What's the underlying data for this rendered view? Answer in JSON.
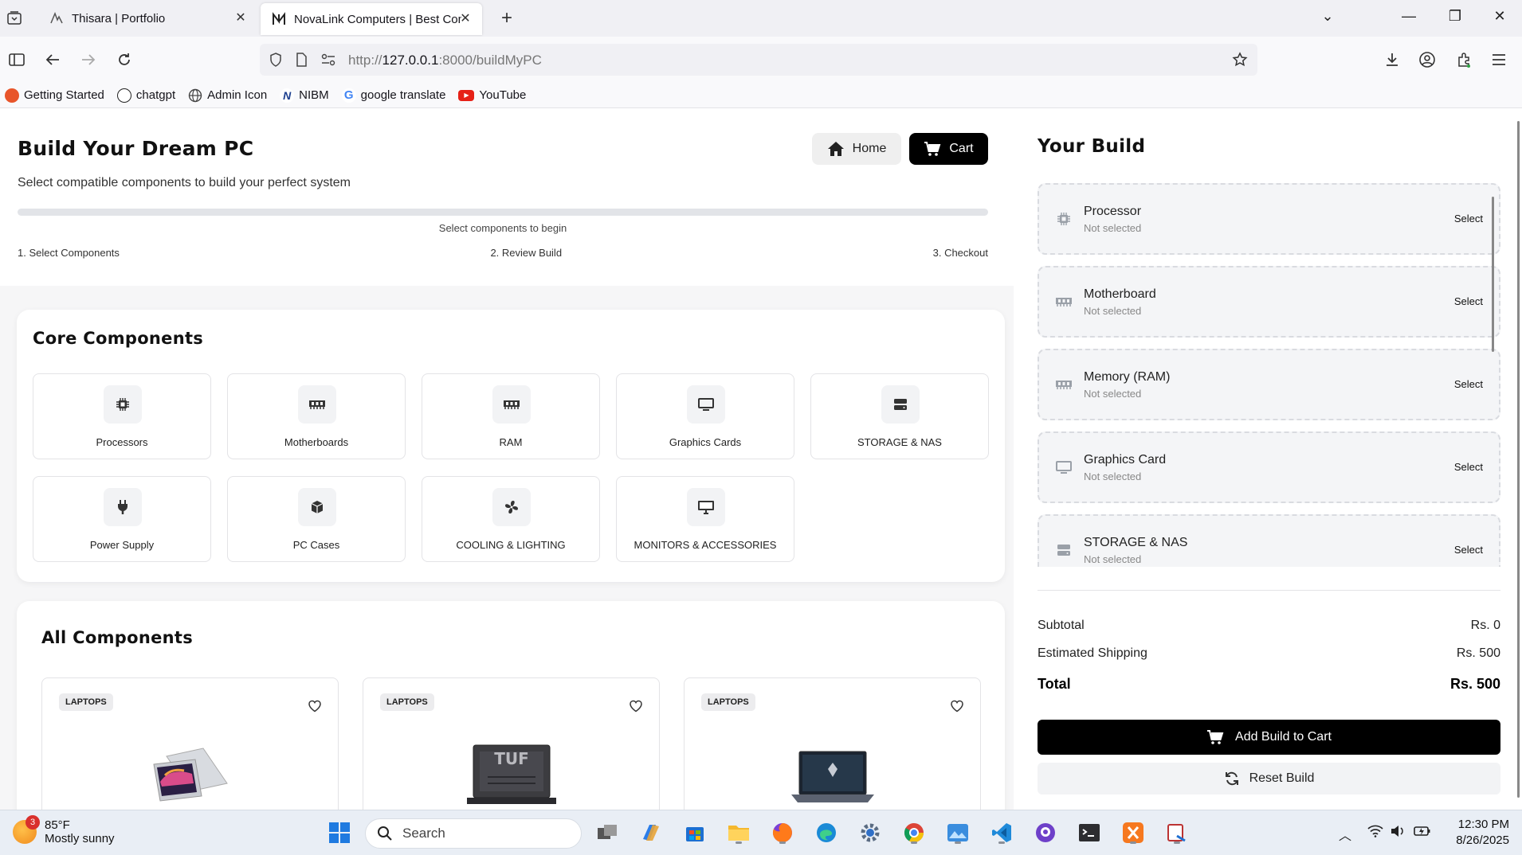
{
  "browser": {
    "tabs": [
      {
        "title": "Thisara | Portfolio",
        "active": false
      },
      {
        "title": "NovaLink Computers | Best Computer Store",
        "active": true
      }
    ],
    "url_prefix": "http://",
    "url_host": "127.0.0.1",
    "url_rest": ":8000/buildMyPC",
    "bookmarks": [
      {
        "label": "Getting Started",
        "icon": "firefox-icon",
        "color": "#e8552a"
      },
      {
        "label": "chatgpt",
        "icon": "openai-icon",
        "color": "#222222"
      },
      {
        "label": "Admin Icon",
        "icon": "globe-icon",
        "color": "#444444"
      },
      {
        "label": "NIBM",
        "icon": "nibm-icon",
        "color": "#1c3f8f"
      },
      {
        "label": "google translate",
        "icon": "google-icon",
        "color": "#4285f4"
      },
      {
        "label": "YouTube",
        "icon": "youtube-icon",
        "color": "#e62117"
      }
    ]
  },
  "header": {
    "title": "Build Your Dream PC",
    "subtitle": "Select compatible components to build your perfect system",
    "home_label": "Home",
    "cart_label": "Cart",
    "progress_fraction": 0,
    "progress_text": "Select components to begin",
    "steps": [
      "1. Select Components",
      "2. Review Build",
      "3. Checkout"
    ]
  },
  "core": {
    "title": "Core Components",
    "categories": [
      {
        "label": "Processors",
        "icon": "cpu-icon"
      },
      {
        "label": "Motherboards",
        "icon": "memory-icon"
      },
      {
        "label": "RAM",
        "icon": "memory-icon"
      },
      {
        "label": "Graphics Cards",
        "icon": "monitor-icon"
      },
      {
        "label": "STORAGE & NAS",
        "icon": "hdd-icon"
      },
      {
        "label": "Power Supply",
        "icon": "plug-icon"
      },
      {
        "label": "PC Cases",
        "icon": "box-icon"
      },
      {
        "label": "COOLING & LIGHTING",
        "icon": "fan-icon"
      },
      {
        "label": "MONITORS & ACCESSORIES",
        "icon": "desktop-icon"
      }
    ]
  },
  "all": {
    "title": "All Components",
    "products": [
      {
        "badge": "LAPTOPS"
      },
      {
        "badge": "LAPTOPS"
      },
      {
        "badge": "LAPTOPS"
      }
    ]
  },
  "build": {
    "title": "Your Build",
    "slots": [
      {
        "name": "Processor",
        "status": "Not selected",
        "action": "Select",
        "icon": "cpu-icon"
      },
      {
        "name": "Motherboard",
        "status": "Not selected",
        "action": "Select",
        "icon": "memory-icon"
      },
      {
        "name": "Memory (RAM)",
        "status": "Not selected",
        "action": "Select",
        "icon": "memory-icon"
      },
      {
        "name": "Graphics Card",
        "status": "Not selected",
        "action": "Select",
        "icon": "monitor-icon"
      },
      {
        "name": "STORAGE & NAS",
        "status": "Not selected",
        "action": "Select",
        "icon": "hdd-icon"
      }
    ],
    "subtotal_label": "Subtotal",
    "subtotal_value": "Rs. 0",
    "shipping_label": "Estimated Shipping",
    "shipping_value": "Rs. 500",
    "total_label": "Total",
    "total_value": "Rs. 500",
    "add_label": "Add Build to Cart",
    "reset_label": "Reset Build"
  },
  "taskbar": {
    "weather_badge": "3",
    "temperature": "85°F",
    "condition": "Mostly sunny",
    "search_placeholder": "Search",
    "time": "12:30 PM",
    "date": "8/26/2025"
  }
}
